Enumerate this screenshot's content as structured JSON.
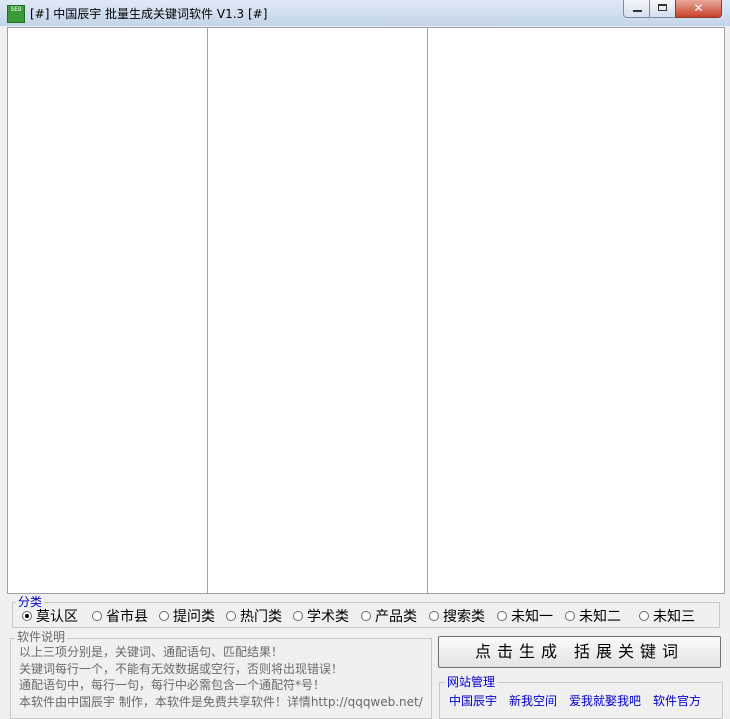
{
  "window": {
    "icon_text": "SEO",
    "title": "[#]  中国辰宇 批量生成关键词软件 V1.3 [#]",
    "close_glyph": "✕"
  },
  "category": {
    "legend": "分类",
    "options": [
      "莫认区",
      "省市县",
      "提问类",
      "热门类",
      "学术类",
      "产品类",
      "搜索类",
      "未知一",
      "未知二",
      "未知三"
    ],
    "selected_index": 0
  },
  "about": {
    "legend": "软件说明",
    "lines": [
      "以上三项分别是，关键词、通配语句、匹配结果！",
      "关键词每行一个，不能有无效数据或空行，否则将出现错误！",
      "通配语句中，每行一句，每行中必需包含一个通配符*号！",
      "本软件由中国辰宇 制作，本软件是免费共享软件！详情http://qqqweb.net/"
    ]
  },
  "generate_button": "点击生成  括展关键词",
  "site": {
    "legend": "网站管理",
    "links": [
      "中国辰宇",
      "新我空间",
      "爱我就娶我吧",
      "软件官方"
    ]
  }
}
